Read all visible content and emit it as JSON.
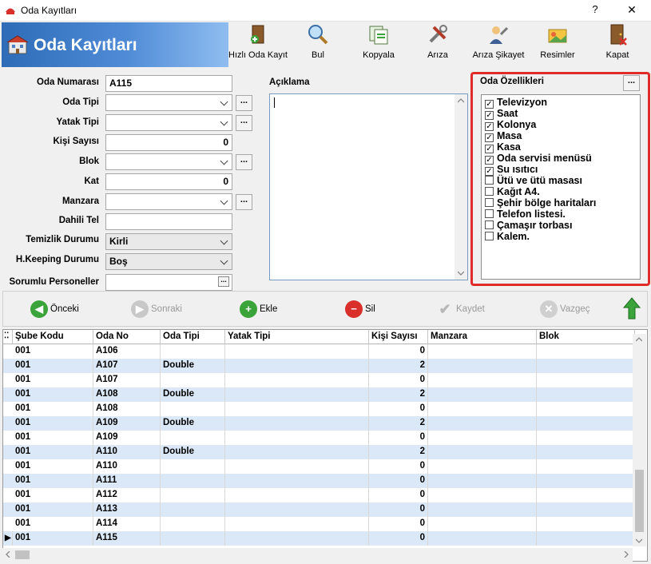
{
  "window": {
    "title": "Oda Kayıtları",
    "help": "?",
    "close": "✕"
  },
  "header": {
    "title": "Oda Kayıtları"
  },
  "toolbar": [
    {
      "label": "Hızlı Oda Kayıt",
      "icon": "quick-room-icon"
    },
    {
      "label": "Bul",
      "icon": "magnifier-icon"
    },
    {
      "label": "Kopyala",
      "icon": "copy-icon"
    },
    {
      "label": "Arıza",
      "icon": "tools-icon"
    },
    {
      "label": "Arıza Şikayet",
      "icon": "complaint-icon"
    },
    {
      "label": "Resimler",
      "icon": "pictures-icon"
    },
    {
      "label": "Kapat",
      "icon": "exit-door-icon"
    }
  ],
  "form": {
    "oda_numarasi": {
      "label": "Oda Numarası",
      "value": "A115"
    },
    "oda_tipi": {
      "label": "Oda Tipi",
      "value": ""
    },
    "yatak_tipi": {
      "label": "Yatak Tipi",
      "value": ""
    },
    "kisi_sayisi": {
      "label": "Kişi Sayısı",
      "value": "0"
    },
    "blok": {
      "label": "Blok",
      "value": ""
    },
    "kat": {
      "label": "Kat",
      "value": "0"
    },
    "manzara": {
      "label": "Manzara",
      "value": ""
    },
    "dahili_tel": {
      "label": "Dahili Tel",
      "value": ""
    },
    "temizlik_durumu": {
      "label": "Temizlik Durumu",
      "value": "Kirli"
    },
    "hkeeping_durumu": {
      "label": "H.Keeping Durumu",
      "value": "Boş"
    },
    "sorumlu_personeller": {
      "label": "Sorumlu Personeller",
      "value": ""
    },
    "ellipsis": "..."
  },
  "aciklama": {
    "label": "Açıklama",
    "value": ""
  },
  "oda_ozellikleri": {
    "label": "Oda Özellikleri",
    "button": "...",
    "items": [
      {
        "label": "Televizyon",
        "checked": true
      },
      {
        "label": "Saat",
        "checked": true
      },
      {
        "label": "Kolonya",
        "checked": true
      },
      {
        "label": "Masa",
        "checked": true
      },
      {
        "label": "Kasa",
        "checked": true
      },
      {
        "label": "Oda servisi menüsü",
        "checked": true
      },
      {
        "label": "Su ısıtıcı",
        "checked": true
      },
      {
        "label": "Ütü ve ütü masası",
        "checked": false
      },
      {
        "label": "Kağıt A4.",
        "checked": false
      },
      {
        "label": "Şehir bölge haritaları",
        "checked": false
      },
      {
        "label": "Telefon listesi.",
        "checked": false
      },
      {
        "label": "Çamaşır torbası",
        "checked": false
      },
      {
        "label": "Kalem.",
        "checked": false
      }
    ]
  },
  "nav": {
    "onceki": "Önceki",
    "sonraki": "Sonraki",
    "ekle": "Ekle",
    "sil": "Sil",
    "kaydet": "Kaydet",
    "vazgec": "Vazgeç"
  },
  "grid": {
    "columns": [
      "Şube Kodu",
      "Oda No",
      "Oda Tipi",
      "Yatak Tipi",
      "Kişi Sayısı",
      "Manzara",
      "Blok"
    ],
    "rows": [
      [
        "001",
        "A106",
        "",
        "",
        "0",
        "",
        ""
      ],
      [
        "001",
        "A107",
        "Double",
        "",
        "2",
        "",
        ""
      ],
      [
        "001",
        "A107",
        "",
        "",
        "0",
        "",
        ""
      ],
      [
        "001",
        "A108",
        "Double",
        "",
        "2",
        "",
        ""
      ],
      [
        "001",
        "A108",
        "",
        "",
        "0",
        "",
        ""
      ],
      [
        "001",
        "A109",
        "Double",
        "",
        "2",
        "",
        ""
      ],
      [
        "001",
        "A109",
        "",
        "",
        "0",
        "",
        ""
      ],
      [
        "001",
        "A110",
        "Double",
        "",
        "2",
        "",
        ""
      ],
      [
        "001",
        "A110",
        "",
        "",
        "0",
        "",
        ""
      ],
      [
        "001",
        "A111",
        "",
        "",
        "0",
        "",
        ""
      ],
      [
        "001",
        "A112",
        "",
        "",
        "0",
        "",
        ""
      ],
      [
        "001",
        "A113",
        "",
        "",
        "0",
        "",
        ""
      ],
      [
        "001",
        "A114",
        "",
        "",
        "0",
        "",
        ""
      ],
      [
        "001",
        "A115",
        "",
        "",
        "0",
        "",
        ""
      ]
    ],
    "current_row": 13
  },
  "colors": {
    "accent": "#2f6cb8",
    "highlight_frame": "#e02b2b",
    "alt_row": "#dbe8f7"
  }
}
